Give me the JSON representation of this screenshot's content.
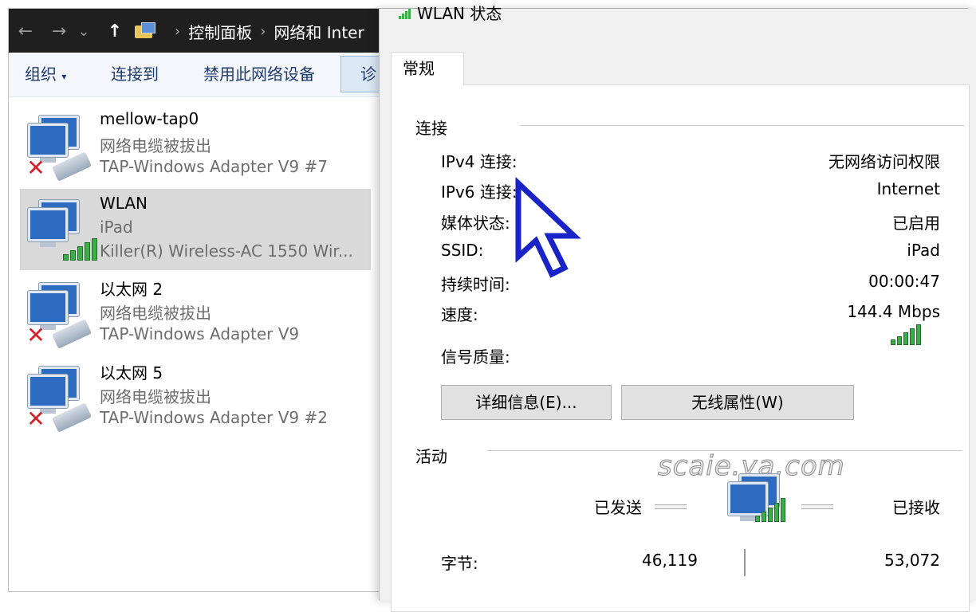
{
  "explorer": {
    "nav": {
      "back": "←",
      "forward": "→",
      "recent": "⌄",
      "up": "↑"
    },
    "breadcrumb": [
      "控制面板",
      "网络和 Inter"
    ],
    "toolbar": {
      "organize": "组织",
      "organize_caret": "▾",
      "connect": "连接到",
      "disable": "禁用此网络设备",
      "partial": "诊"
    },
    "adapters": [
      {
        "name": "mellow-tap0",
        "status": "网络电缆被拔出",
        "device": "TAP-Windows Adapter V9 #7",
        "state": "disconnected",
        "selected": false
      },
      {
        "name": "WLAN",
        "status": "iPad",
        "device": "Killer(R) Wireless-AC 1550 Wir...",
        "state": "wireless",
        "selected": true
      },
      {
        "name": "以太网 2",
        "status": "网络电缆被拔出",
        "device": "TAP-Windows Adapter V9",
        "state": "disconnected",
        "selected": false
      },
      {
        "name": "以太网 5",
        "status": "网络电缆被拔出",
        "device": "TAP-Windows Adapter V9 #2",
        "state": "disconnected",
        "selected": false
      }
    ]
  },
  "dialog": {
    "title": "WLAN 状态",
    "tab": "常规",
    "connection": {
      "heading": "连接",
      "rows": [
        {
          "label": "IPv4 连接:",
          "value": "无网络访问权限"
        },
        {
          "label": "IPv6 连接:",
          "value": "Internet"
        },
        {
          "label": "媒体状态:",
          "value": "已启用"
        },
        {
          "label": "SSID:",
          "value": "iPad"
        },
        {
          "label": "持续时间:",
          "value": "00:00:47"
        },
        {
          "label": "速度:",
          "value": "144.4 Mbps"
        }
      ],
      "signal_label": "信号质量:",
      "signal_bars": 5
    },
    "buttons": {
      "details": "详细信息(E)...",
      "wireless": "无线属性(W)"
    },
    "activity": {
      "heading": "活动",
      "sent_label": "已发送",
      "received_label": "已接收",
      "bytes_label": "字节:",
      "bytes_sent": "46,119",
      "bytes_received": "53,072"
    },
    "watermark": "scaie.ya.com"
  },
  "colors": {
    "accent_green": "#3cae49",
    "error_red": "#d8202a",
    "cursor_blue": "#1a23c8",
    "addressbar": "#1f1f1f"
  }
}
